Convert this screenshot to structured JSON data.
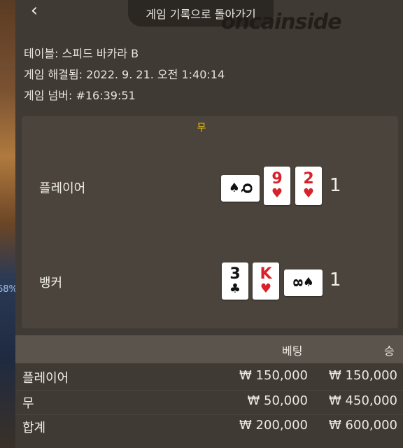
{
  "header": {
    "back_label": "게임 기록으로 돌아가기",
    "watermark": "oncainside"
  },
  "background": {
    "percent": "68%"
  },
  "info": {
    "table": "테이블: 스피드 바카라 B",
    "resolved": "게임 해결됨: 2022. 9. 21. 오전 1:40:14",
    "number": "게임 넘버: #16:39:51"
  },
  "result": {
    "outcome": "무",
    "player": {
      "label": "플레이어",
      "cards": [
        {
          "rank": "9",
          "suit": "♥",
          "color": "#d8212a"
        },
        {
          "rank": "2",
          "suit": "♥",
          "color": "#d8212a"
        }
      ],
      "side_card": {
        "rank": "Q",
        "suit": "♠"
      },
      "score": "1"
    },
    "banker": {
      "label": "뱅커",
      "cards": [
        {
          "rank": "3",
          "suit": "♣",
          "color": "#111111"
        },
        {
          "rank": "K",
          "suit": "♥",
          "color": "#d8212a"
        }
      ],
      "side_card": {
        "rank": "8",
        "suit": "♠"
      },
      "score": "1"
    }
  },
  "bets": {
    "headers": [
      "베팅",
      "승"
    ],
    "rows": [
      {
        "label": "플레이어",
        "bet": "₩ 150,000",
        "win": "₩ 150,000"
      },
      {
        "label": "무",
        "bet": "₩ 50,000",
        "win": "₩ 450,000"
      },
      {
        "label": "합계",
        "bet": "₩ 200,000",
        "win": "₩ 600,000"
      }
    ]
  }
}
